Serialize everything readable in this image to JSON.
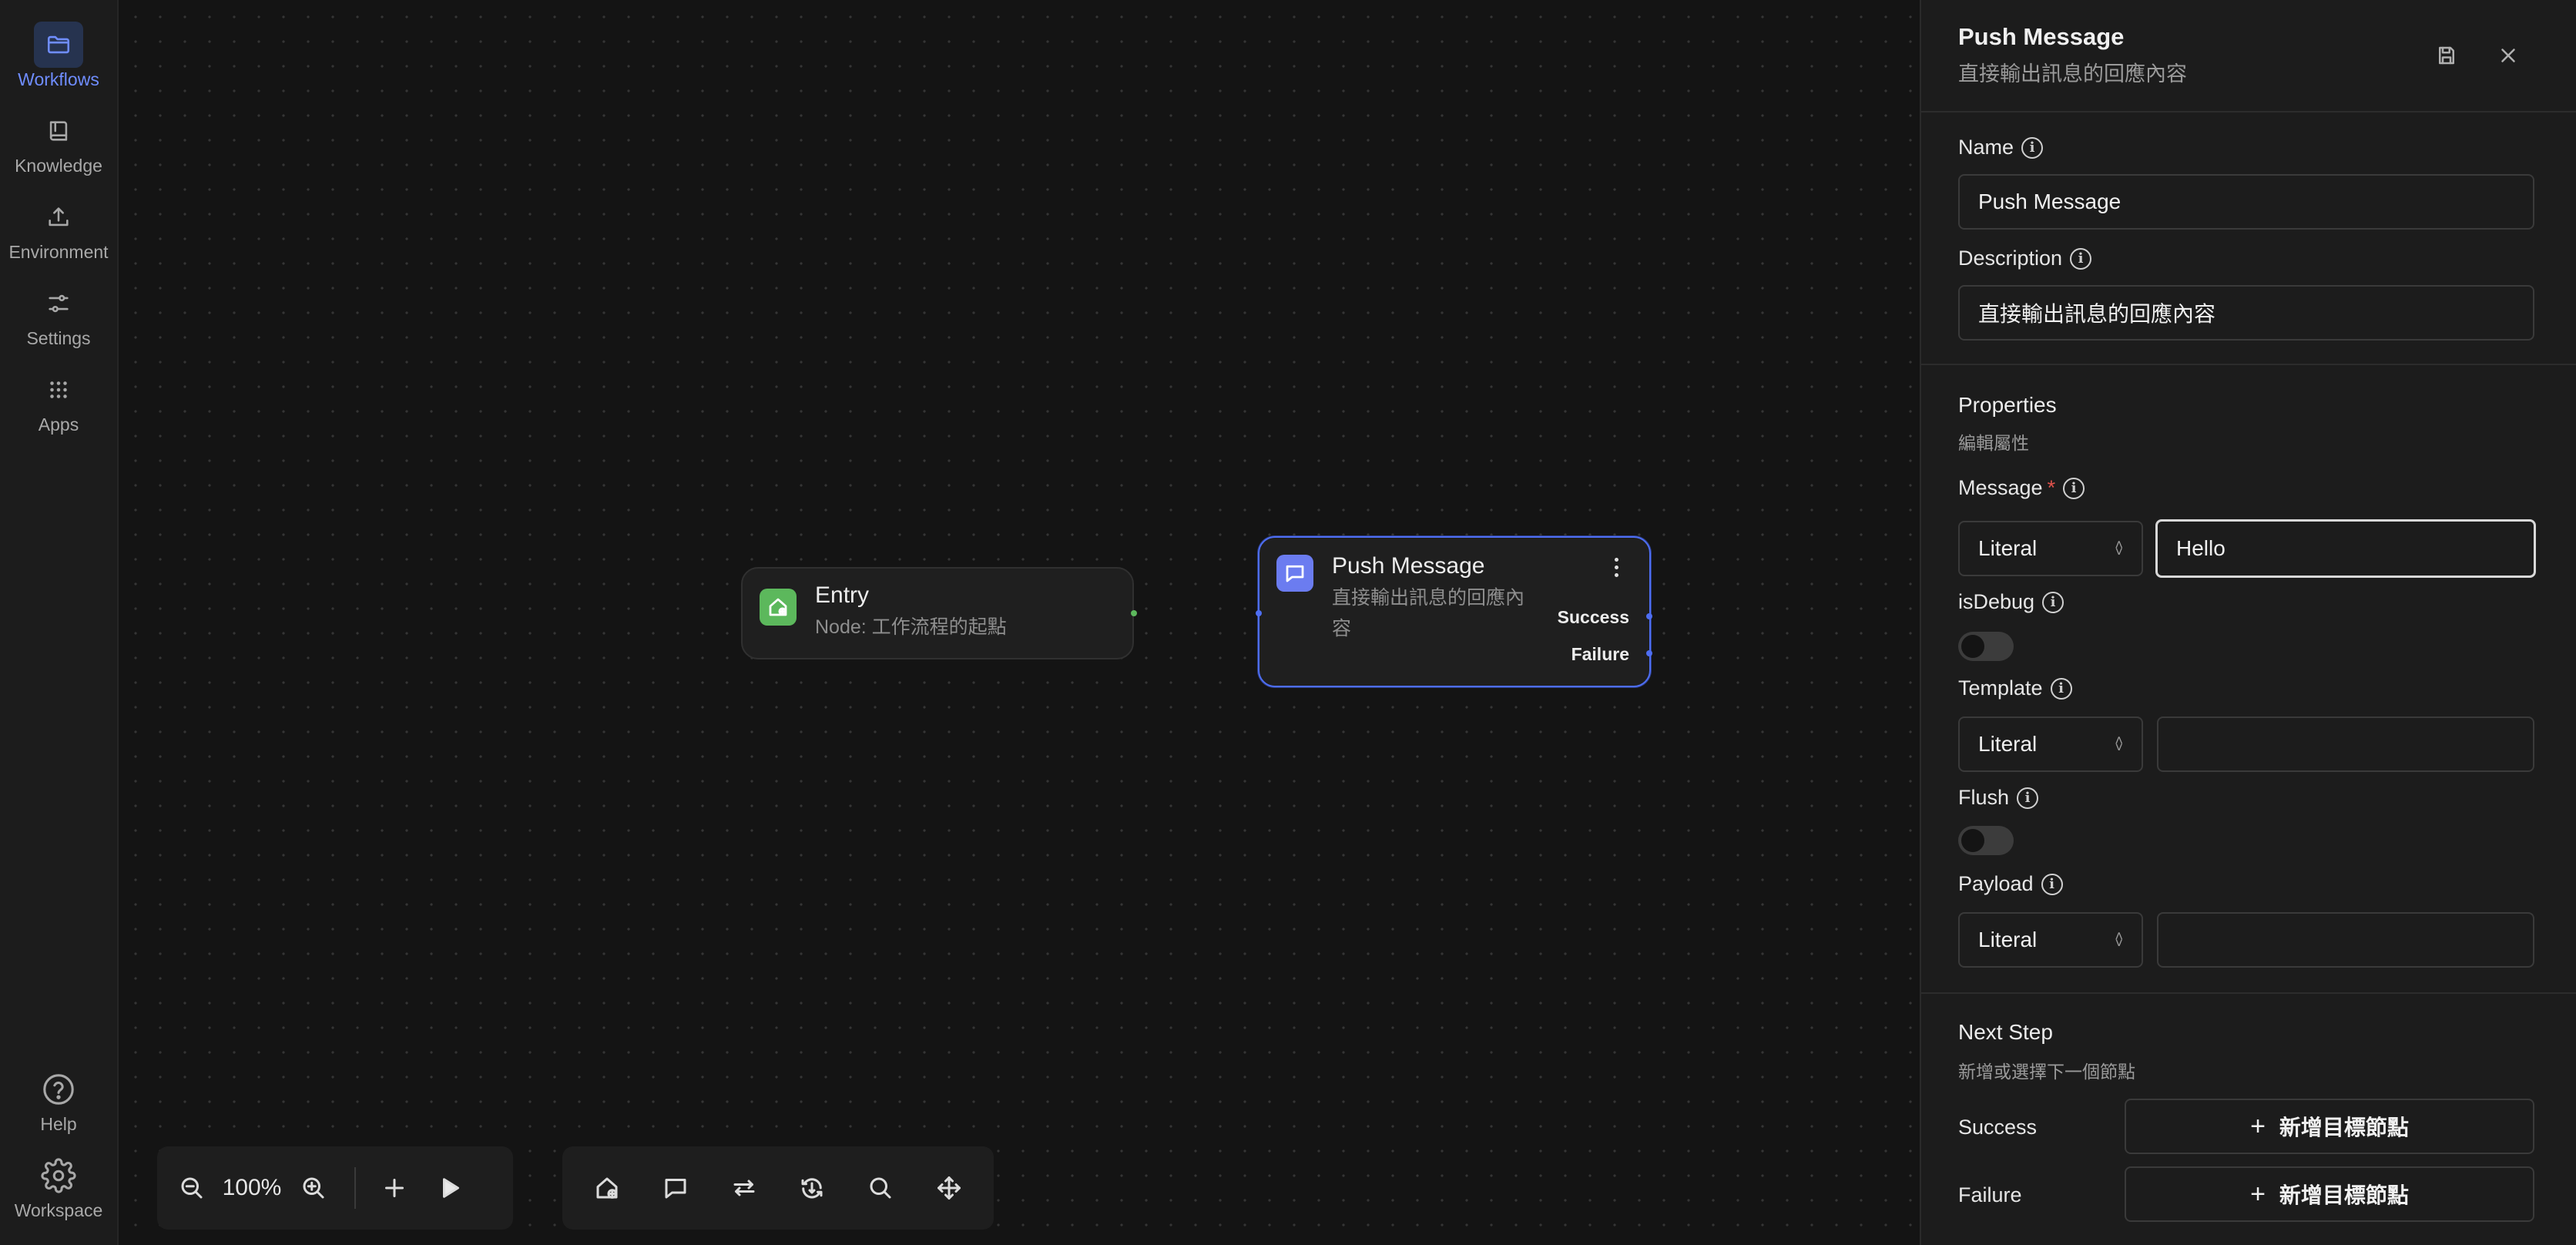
{
  "sidebar": {
    "items": [
      {
        "label": "Workflows",
        "icon": "folder-icon",
        "active": true
      },
      {
        "label": "Knowledge",
        "icon": "book-icon"
      },
      {
        "label": "Environment",
        "icon": "upload-icon"
      },
      {
        "label": "Settings",
        "icon": "sliders-icon"
      },
      {
        "label": "Apps",
        "icon": "grid-icon"
      }
    ],
    "bottom": [
      {
        "label": "Help",
        "icon": "help-circle-icon"
      },
      {
        "label": "Workspace",
        "icon": "gear-icon"
      }
    ]
  },
  "canvas": {
    "entry_node": {
      "title": "Entry",
      "subtitle": "Node: 工作流程的起點",
      "color": "#5cb85c"
    },
    "push_node": {
      "title": "Push Message",
      "subtitle": "直接輸出訊息的回應內容",
      "color": "#6b7cf0",
      "outputs": [
        "Success",
        "Failure"
      ]
    },
    "zoom_level": "100%"
  },
  "panel": {
    "title": "Push Message",
    "subtitle": "直接輸出訊息的回應內容",
    "name_label": "Name",
    "name_value": "Push Message",
    "description_label": "Description",
    "description_value": "直接輸出訊息的回應內容",
    "properties_title": "Properties",
    "properties_sub": "編輯屬性",
    "message_label": "Message",
    "message_required": "*",
    "message_type": "Literal",
    "message_value": "Hello",
    "isdebug_label": "isDebug",
    "isdebug_on": false,
    "template_label": "Template",
    "template_type": "Literal",
    "template_value": "",
    "flush_label": "Flush",
    "flush_on": false,
    "payload_label": "Payload",
    "payload_type": "Literal",
    "payload_value": "",
    "next_step_title": "Next Step",
    "next_step_sub": "新增或選擇下一個節點",
    "success_label": "Success",
    "failure_label": "Failure",
    "add_target_label": "新增目標節點"
  },
  "colors": {
    "accent": "#6f8dff",
    "entry_green": "#5cb85c",
    "node_blue": "#6b7cf0",
    "node_border_selected": "#4e6ef2"
  }
}
